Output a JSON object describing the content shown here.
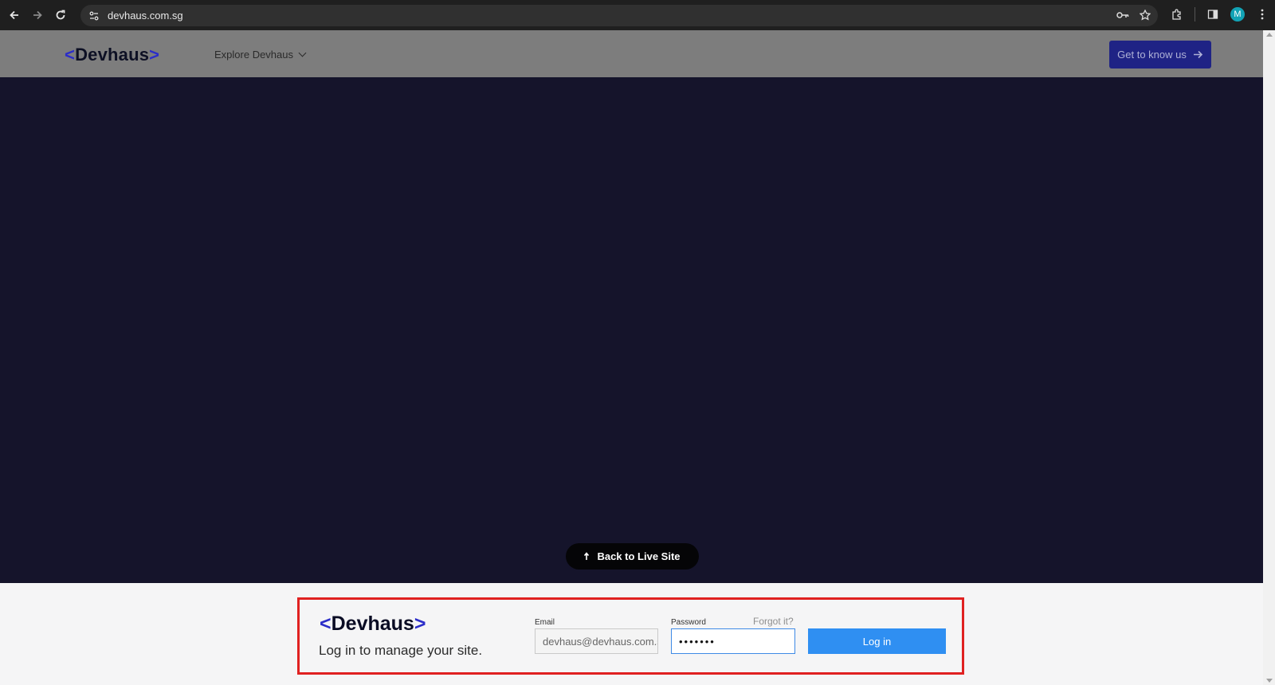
{
  "browser": {
    "url": "devhaus.com.sg",
    "avatar_initial": "M"
  },
  "site_header": {
    "logo_open": "<",
    "logo_text": "Devhaus",
    "logo_close": ">",
    "explore_label": "Explore Devhaus",
    "cta_label": "Get to know us"
  },
  "overlay": {
    "back_label": "Back to Live Site"
  },
  "login": {
    "logo_open": "<",
    "logo_text": "Devhaus",
    "logo_close": ">",
    "tagline": "Log in to manage your site.",
    "email_label": "Email",
    "email_value": "devhaus@devhaus.com.sg",
    "password_label": "Password",
    "password_value": "•••••••",
    "forgot_label": "Forgot it?",
    "submit_label": "Log in"
  },
  "colors": {
    "page_bg": "#15142b",
    "header_bg": "#7d7d7d",
    "cta_bg": "#1f2385",
    "brand_bracket": "#2b2dc9",
    "login_button": "#2f8ff2",
    "highlight_border": "#e02121"
  }
}
